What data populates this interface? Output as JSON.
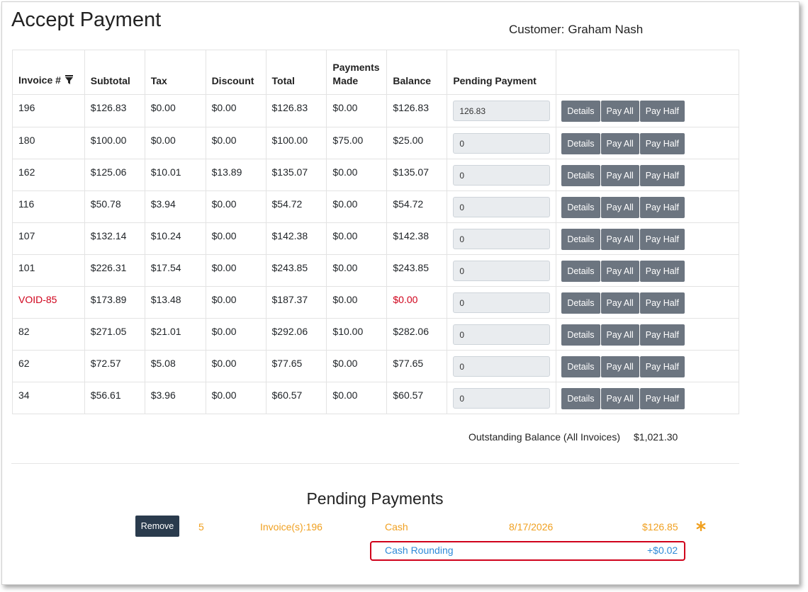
{
  "page": {
    "title": "Accept Payment",
    "customer_label": "Customer:",
    "customer_name": "Graham Nash"
  },
  "table": {
    "headers": {
      "invoice": "Invoice #",
      "subtotal": "Subtotal",
      "tax": "Tax",
      "discount": "Discount",
      "total": "Total",
      "payments_made_1": "Payments",
      "payments_made_2": "Made",
      "balance": "Balance",
      "pending": "Pending Payment"
    },
    "rows": [
      {
        "invoice": "196",
        "subtotal": "$126.83",
        "tax": "$0.00",
        "discount": "$0.00",
        "total": "$126.83",
        "payments_made": "$0.00",
        "balance": "$126.83",
        "pending": "126.83",
        "void": false
      },
      {
        "invoice": "180",
        "subtotal": "$100.00",
        "tax": "$0.00",
        "discount": "$0.00",
        "total": "$100.00",
        "payments_made": "$75.00",
        "balance": "$25.00",
        "pending": "0",
        "void": false
      },
      {
        "invoice": "162",
        "subtotal": "$125.06",
        "tax": "$10.01",
        "discount": "$13.89",
        "total": "$135.07",
        "payments_made": "$0.00",
        "balance": "$135.07",
        "pending": "0",
        "void": false
      },
      {
        "invoice": "116",
        "subtotal": "$50.78",
        "tax": "$3.94",
        "discount": "$0.00",
        "total": "$54.72",
        "payments_made": "$0.00",
        "balance": "$54.72",
        "pending": "0",
        "void": false
      },
      {
        "invoice": "107",
        "subtotal": "$132.14",
        "tax": "$10.24",
        "discount": "$0.00",
        "total": "$142.38",
        "payments_made": "$0.00",
        "balance": "$142.38",
        "pending": "0",
        "void": false
      },
      {
        "invoice": "101",
        "subtotal": "$226.31",
        "tax": "$17.54",
        "discount": "$0.00",
        "total": "$243.85",
        "payments_made": "$0.00",
        "balance": "$243.85",
        "pending": "0",
        "void": false
      },
      {
        "invoice": "VOID-85",
        "subtotal": "$173.89",
        "tax": "$13.48",
        "discount": "$0.00",
        "total": "$187.37",
        "payments_made": "$0.00",
        "balance": "$0.00",
        "pending": "0",
        "void": true
      },
      {
        "invoice": "82",
        "subtotal": "$271.05",
        "tax": "$21.01",
        "discount": "$0.00",
        "total": "$292.06",
        "payments_made": "$10.00",
        "balance": "$282.06",
        "pending": "0",
        "void": false
      },
      {
        "invoice": "62",
        "subtotal": "$72.57",
        "tax": "$5.08",
        "discount": "$0.00",
        "total": "$77.65",
        "payments_made": "$0.00",
        "balance": "$77.65",
        "pending": "0",
        "void": false
      },
      {
        "invoice": "34",
        "subtotal": "$56.61",
        "tax": "$3.96",
        "discount": "$0.00",
        "total": "$60.57",
        "payments_made": "$0.00",
        "balance": "$60.57",
        "pending": "0",
        "void": false
      }
    ],
    "buttons": {
      "details": "Details",
      "pay_all": "Pay All",
      "pay_half": "Pay Half"
    }
  },
  "summary": {
    "outstanding_label": "Outstanding Balance (All Invoices)",
    "outstanding_value": "$1,021.30"
  },
  "pending_payments": {
    "title": "Pending Payments",
    "remove_label": "Remove",
    "entry": {
      "number": "5",
      "invoices": "Invoice(s):196",
      "method": "Cash",
      "date": "8/17/2026",
      "amount": "$126.85"
    },
    "rounding_label": "Cash Rounding",
    "rounding_value": "+$0.02"
  },
  "icons": {
    "filter": "filter-icon",
    "star": "asterisk-icon"
  },
  "colors": {
    "void_text": "#d0021b",
    "pending_text": "#f0a020",
    "rounding_text": "#2e8ad8",
    "highlight_border": "#d0021b",
    "button_grey": "#6c7580",
    "button_dark": "#2a3b4d"
  }
}
